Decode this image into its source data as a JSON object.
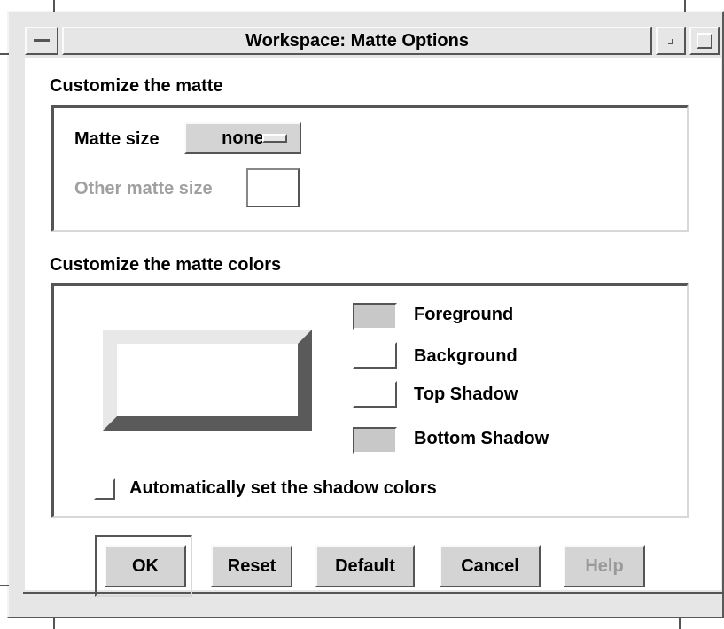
{
  "window": {
    "title": "Workspace: Matte Options",
    "menu_icon": "window-menu-icon",
    "minimize_icon": "minimize-icon",
    "maximize_icon": "maximize-icon"
  },
  "matte": {
    "section_label": "Customize the matte",
    "size_label": "Matte size",
    "size_value": "none",
    "other_size_label": "Other matte size",
    "other_size_value": ""
  },
  "colors": {
    "section_label": "Customize the matte colors",
    "foreground_label": "Foreground",
    "background_label": "Background",
    "top_shadow_label": "Top Shadow",
    "bottom_shadow_label": "Bottom Shadow",
    "auto_shadow_label": "Automatically set the shadow colors",
    "auto_shadow_checked": false,
    "foreground_color": "#c8c8c8",
    "background_color": "#ffffff",
    "top_shadow_color": "#ffffff",
    "bottom_shadow_color": "#c8c8c8"
  },
  "buttons": {
    "ok": "OK",
    "reset": "Reset",
    "default": "Default",
    "cancel": "Cancel",
    "help": "Help"
  }
}
